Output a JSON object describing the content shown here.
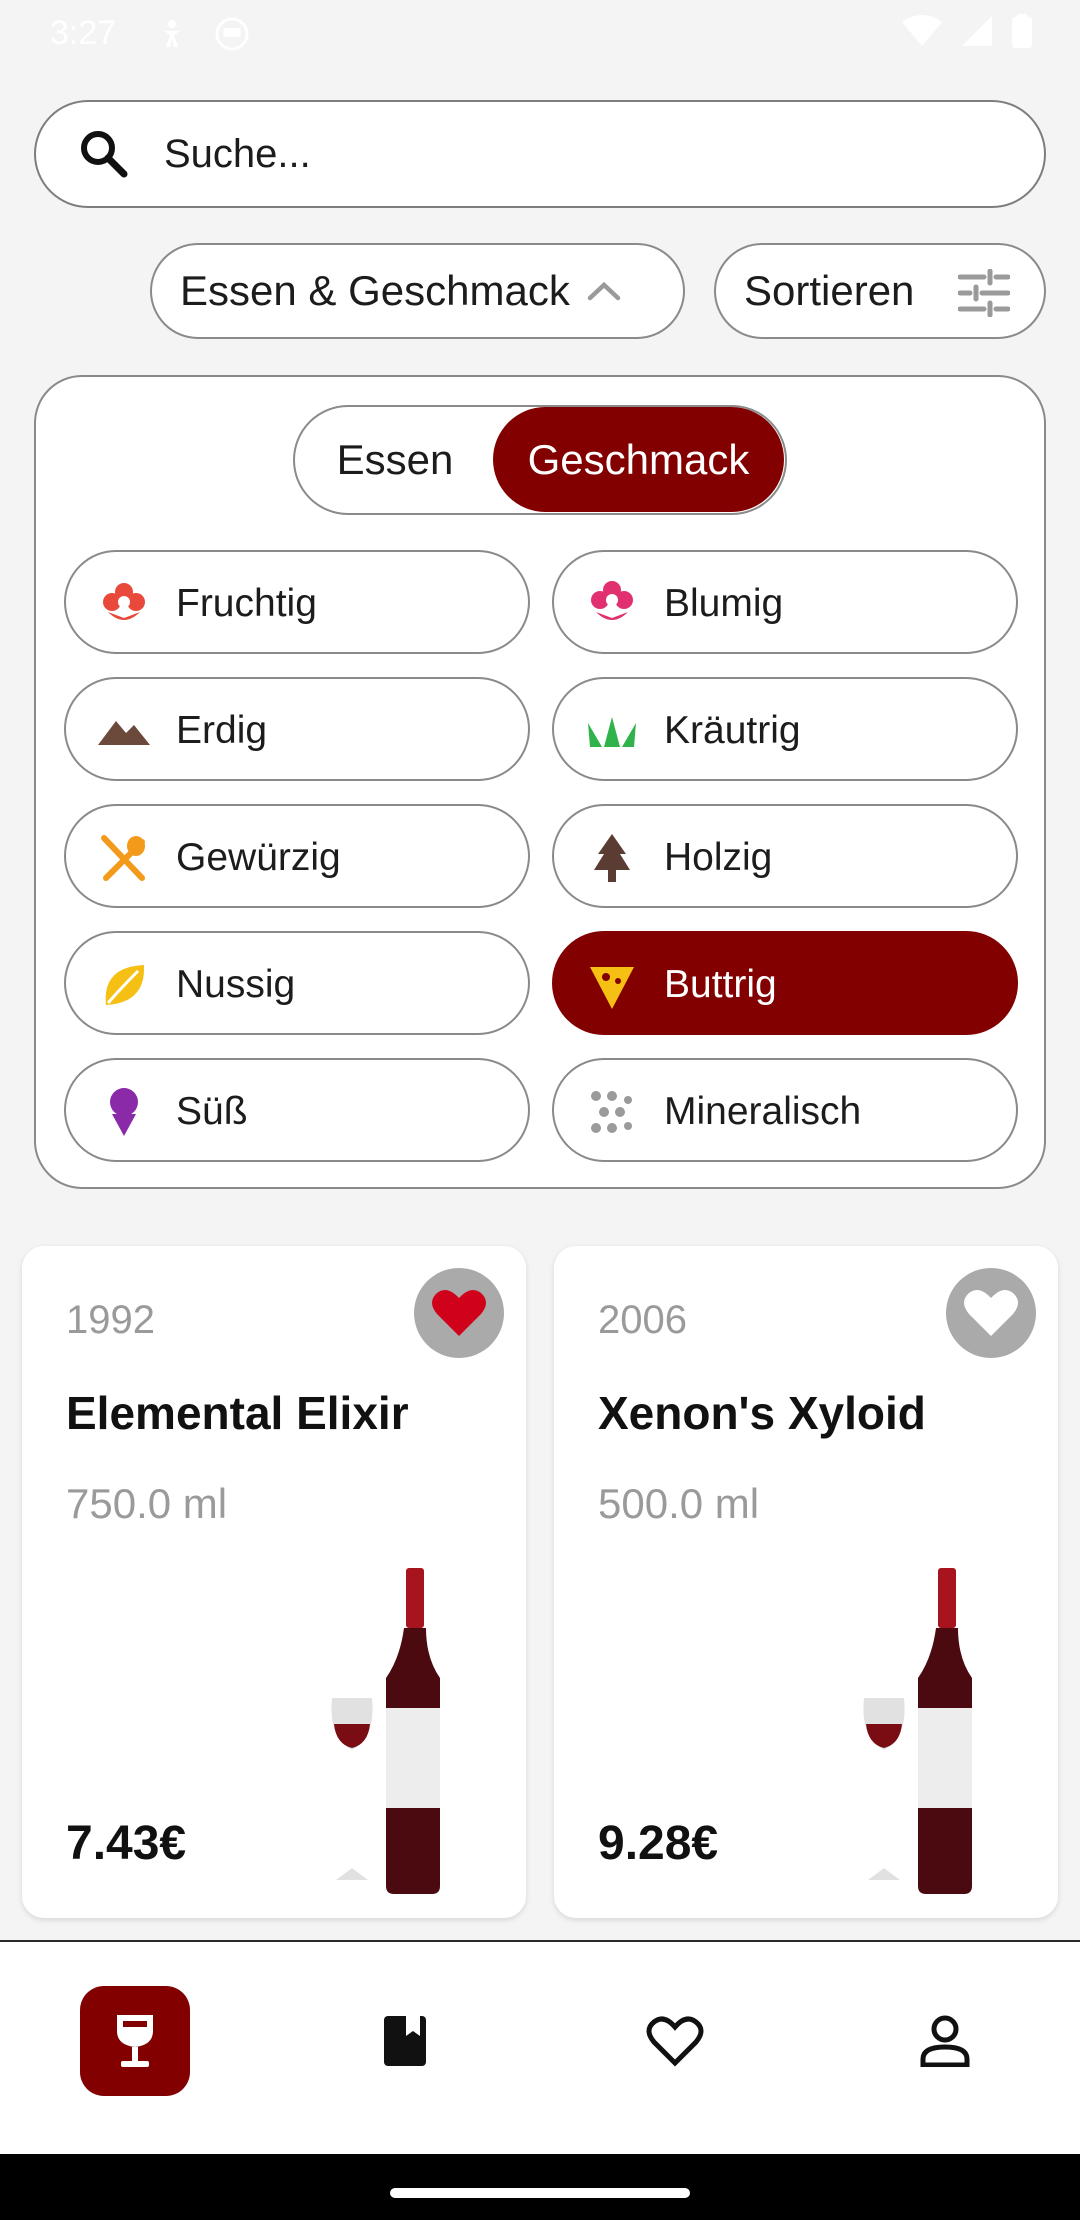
{
  "status_bar": {
    "time": "3:27"
  },
  "search": {
    "placeholder": "Suche..."
  },
  "filters": {
    "food_taste_label": "Essen & Geschmack",
    "sort_label": "Sortieren"
  },
  "panel": {
    "segments": [
      "Essen",
      "Geschmack"
    ],
    "selected_segment": "Geschmack",
    "tastes": [
      {
        "label": "Fruchtig",
        "icon": "fruit-flower-icon",
        "color": "#e8493a",
        "selected": false
      },
      {
        "label": "Blumig",
        "icon": "flower-icon",
        "color": "#e0306f",
        "selected": false
      },
      {
        "label": "Erdig",
        "icon": "mountain-icon",
        "color": "#6b4a3c",
        "selected": false
      },
      {
        "label": "Kräutrig",
        "icon": "grass-icon",
        "color": "#2fb34a",
        "selected": false
      },
      {
        "label": "Gewürzig",
        "icon": "utensils-icon",
        "color": "#f39a1a",
        "selected": false
      },
      {
        "label": "Holzig",
        "icon": "tree-icon",
        "color": "#5b3c32",
        "selected": false
      },
      {
        "label": "Nussig",
        "icon": "leaf-icon",
        "color": "#f5c013",
        "selected": false
      },
      {
        "label": "Buttrig",
        "icon": "cheese-icon",
        "color": "#f5c013",
        "selected": true
      },
      {
        "label": "Süß",
        "icon": "icecream-icon",
        "color": "#8a2aa8",
        "selected": false
      },
      {
        "label": "Mineralisch",
        "icon": "dots-icon",
        "color": "#9a9a9a",
        "selected": false
      }
    ]
  },
  "wines": [
    {
      "year": "1992",
      "name": "Elemental Elixir",
      "volume": "750.0 ml",
      "price": "7.43€",
      "favorite": true
    },
    {
      "year": "2006",
      "name": "Xenon's Xyloid",
      "volume": "500.0 ml",
      "price": "9.28€",
      "favorite": false
    }
  ],
  "colors": {
    "accent": "#820000",
    "favorite_heart": "#d0021b"
  },
  "nav": [
    "wine-glass-icon",
    "book-icon",
    "heart-icon",
    "person-icon"
  ]
}
